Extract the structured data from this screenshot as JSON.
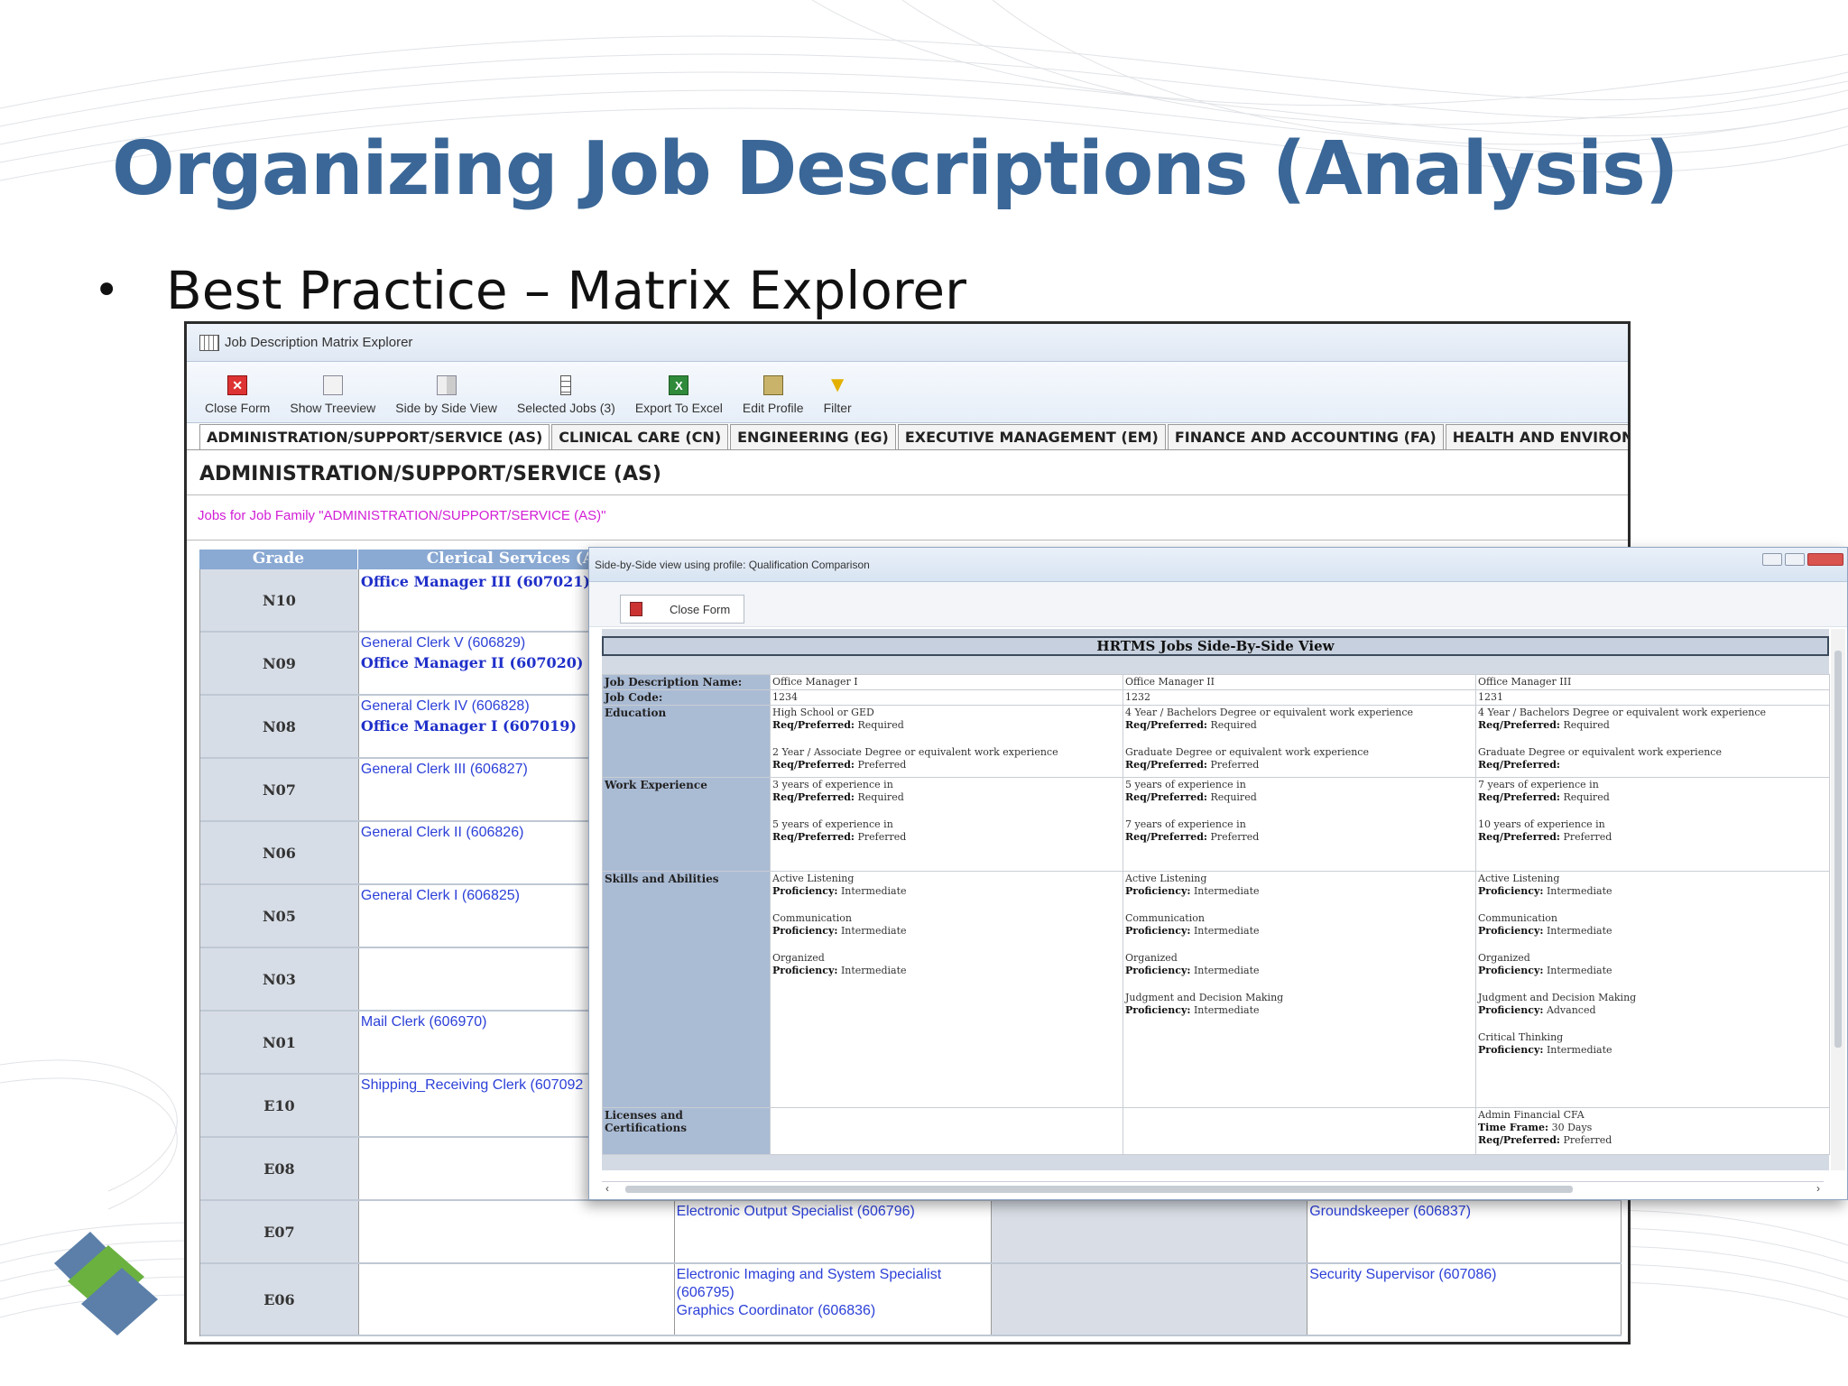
{
  "slide": {
    "title": "Organizing Job Descriptions  (Analysis)",
    "bullet": "Best Practice – Matrix Explorer"
  },
  "window": {
    "title": "Job Description Matrix Explorer",
    "toolbar": [
      {
        "label": "Close Form",
        "icon": "close-icon"
      },
      {
        "label": "Show Treeview",
        "icon": "treeview-icon"
      },
      {
        "label": "Side by Side View",
        "icon": "side-by-side-icon"
      },
      {
        "label": "Selected Jobs (3)",
        "icon": "selected-jobs-icon"
      },
      {
        "label": "Export To Excel",
        "icon": "excel-icon"
      },
      {
        "label": "Edit Profile",
        "icon": "edit-profile-icon"
      },
      {
        "label": "Filter",
        "icon": "filter-icon"
      }
    ],
    "tabs": [
      "ADMINISTRATION/SUPPORT/SERVICE (AS)",
      "CLINICAL CARE (CN)",
      "ENGINEERING (EG)",
      "EXECUTIVE MANAGEMENT (EM)",
      "FINANCE AND ACCOUNTING (FA)",
      "HEALTH AND ENVIRON"
    ],
    "family_heading": "ADMINISTRATION/SUPPORT/SERVICE (AS)",
    "jobs_caption": "Jobs for Job Family \"ADMINISTRATION/SUPPORT/SERVICE (AS)\"",
    "grid": {
      "col_grade": "Grade",
      "col_1": "Clerical Services (AS",
      "rows": [
        {
          "grade": "N10",
          "c1": [
            {
              "t": "Office Manager III (607021)",
              "b": true
            }
          ],
          "c2": [],
          "c3": [],
          "c4": []
        },
        {
          "grade": "N09",
          "c1": [
            {
              "t": "General Clerk V (606829)",
              "b": false
            },
            {
              "t": "Office Manager II (607020)",
              "b": true
            }
          ],
          "c2": [],
          "c3": [],
          "c4": []
        },
        {
          "grade": "N08",
          "c1": [
            {
              "t": "General Clerk IV (606828)",
              "b": false
            },
            {
              "t": "Office Manager I (607019)",
              "b": true
            }
          ],
          "c2": [],
          "c3": [],
          "c4": []
        },
        {
          "grade": "N07",
          "c1": [
            {
              "t": "General Clerk III (606827)",
              "b": false
            }
          ],
          "c2": [],
          "c3": [],
          "c4": []
        },
        {
          "grade": "N06",
          "c1": [
            {
              "t": "General Clerk II (606826)",
              "b": false
            }
          ],
          "c2": [],
          "c3": [],
          "c4": []
        },
        {
          "grade": "N05",
          "c1": [
            {
              "t": "General Clerk I (606825)",
              "b": false
            }
          ],
          "c2": [],
          "c3": [],
          "c4": []
        },
        {
          "grade": "N03",
          "c1": [],
          "c2": [],
          "c3": [],
          "c4": []
        },
        {
          "grade": "N01",
          "c1": [
            {
              "t": "Mail Clerk (606970)",
              "b": false
            }
          ],
          "c2": [],
          "c3": [],
          "c4": []
        },
        {
          "grade": "E10",
          "c1": [
            {
              "t": "Shipping_Receiving Clerk (607092",
              "b": false
            }
          ],
          "c2": [],
          "c3": [],
          "c4": []
        },
        {
          "grade": "E08",
          "c1": [],
          "c2": [],
          "c3": [],
          "c4": []
        },
        {
          "grade": "E07",
          "c1": [],
          "c2": [
            {
              "t": "Electronic Output Specialist (606796)",
              "b": false
            }
          ],
          "c3": [],
          "c4": [
            {
              "t": "Groundskeeper (606837)",
              "b": false
            }
          ]
        },
        {
          "grade": "E06",
          "c1": [],
          "c2": [
            {
              "t": "Electronic Imaging and System Specialist (606795)",
              "b": false
            },
            {
              "t": "Graphics Coordinator (606836)",
              "b": false
            }
          ],
          "c3": [],
          "c4": [
            {
              "t": "Security Supervisor (607086)",
              "b": false
            }
          ]
        }
      ]
    }
  },
  "overlay": {
    "title": "Side-by-Side view using profile: Qualification Comparison",
    "close_label": "Close Form",
    "header": "HRTMS Jobs Side-By-Side View",
    "labels": {
      "name": "Job Description Name:",
      "code": "Job Code:",
      "education": "Education",
      "work": "Work Experience",
      "skills": "Skills and Abilities",
      "licenses": "Licenses and Certifications"
    },
    "req_label": "Req/Preferred:",
    "prof_label": "Proficiency:",
    "time_label": "Time Frame:",
    "jobs": [
      {
        "name": "Office Manager I",
        "code": "1234",
        "education": [
          {
            "text": "High School or GED",
            "req": "Required"
          },
          {
            "text": "2 Year / Associate Degree or equivalent work experience",
            "req": "Preferred"
          }
        ],
        "work": [
          {
            "text": "3 years of experience in",
            "req": "Required"
          },
          {
            "text": "5 years of experience in",
            "req": "Preferred"
          }
        ],
        "skills": [
          {
            "text": "Active Listening",
            "prof": "Intermediate"
          },
          {
            "text": "Communication",
            "prof": "Intermediate"
          },
          {
            "text": "Organized",
            "prof": "Intermediate"
          }
        ],
        "license": null
      },
      {
        "name": "Office Manager II",
        "code": "1232",
        "education": [
          {
            "text": "4 Year / Bachelors Degree or equivalent work experience",
            "req": "Required"
          },
          {
            "text": "Graduate Degree or equivalent work experience",
            "req": "Preferred"
          }
        ],
        "work": [
          {
            "text": "5 years of experience in",
            "req": "Required"
          },
          {
            "text": "7 years of experience in",
            "req": "Preferred"
          }
        ],
        "skills": [
          {
            "text": "Active Listening",
            "prof": "Intermediate"
          },
          {
            "text": "Communication",
            "prof": "Intermediate"
          },
          {
            "text": "Organized",
            "prof": "Intermediate"
          },
          {
            "text": "Judgment and Decision Making",
            "prof": "Intermediate"
          }
        ],
        "license": null
      },
      {
        "name": "Office Manager III",
        "code": "1231",
        "education": [
          {
            "text": "4 Year / Bachelors Degree or equivalent work experience",
            "req": "Required"
          },
          {
            "text": "Graduate Degree or equivalent work experience",
            "req": ""
          }
        ],
        "work": [
          {
            "text": "7 years of experience in",
            "req": "Required"
          },
          {
            "text": "10 years of experience in",
            "req": "Preferred"
          }
        ],
        "skills": [
          {
            "text": "Active Listening",
            "prof": "Intermediate"
          },
          {
            "text": "Communication",
            "prof": "Intermediate"
          },
          {
            "text": "Organized",
            "prof": "Intermediate"
          },
          {
            "text": "Judgment and Decision Making",
            "prof": "Advanced"
          },
          {
            "text": "Critical Thinking",
            "prof": "Intermediate"
          }
        ],
        "license": {
          "text": "Admin Financial CFA",
          "time": "30 Days",
          "req": "Preferred"
        }
      }
    ]
  },
  "colors": {
    "title": "#3a6797",
    "link": "#2c40d8",
    "caption": "#d21ed6",
    "grid_header": "#8aa9d3",
    "sbs_label": "#aabbd4"
  }
}
